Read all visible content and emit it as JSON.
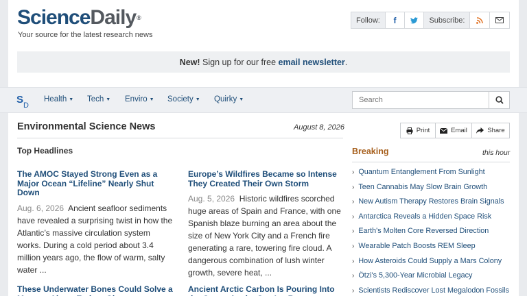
{
  "brand": {
    "science": "Science",
    "daily": "Daily",
    "reg": "®",
    "tagline": "Your source for the latest research news"
  },
  "social": {
    "follow_label": "Follow:",
    "subscribe_label": "Subscribe:"
  },
  "banner": {
    "new_label": "New!",
    "text": " Sign up for our free ",
    "link": "email newsletter",
    "end": "."
  },
  "nav": {
    "logo_s": "S",
    "logo_d": "D",
    "items": [
      {
        "label": "Health"
      },
      {
        "label": "Tech"
      },
      {
        "label": "Enviro"
      },
      {
        "label": "Society"
      },
      {
        "label": "Quirky"
      }
    ],
    "search_placeholder": "Search"
  },
  "main": {
    "title": "Environmental Science News",
    "date": "August 8, 2026",
    "top_headlines": "Top Headlines",
    "stories": [
      {
        "title": "The AMOC Stayed Strong Even as a Major Ocean “Lifeline” Nearly Shut Down",
        "date": "Aug. 6, 2026",
        "summary": "Ancient seafloor sediments have revealed a surprising twist in how the Atlantic’s massive circulation system works. During a cold period about 3.4 million years ago, the flow of warm, salty water ..."
      },
      {
        "title": "Europe’s Wildfires Became so Intense They Created Their Own Storm",
        "date": "Aug. 5, 2026",
        "summary": "Historic wildfires scorched huge areas of Spain and France, with one Spanish blaze burning an area about the size of New York City and a French fire generating a rare, towering fire cloud. A dangerous combination of lush winter growth, severe heat, ..."
      },
      {
        "title": "These Underwater Bones Could Solve a Mystery About Extinct Giants",
        "date": "",
        "summary": ""
      },
      {
        "title": "Ancient Arctic Carbon Is Pouring Into the Ocean As the Sea Ice Retreats",
        "date": "",
        "summary": ""
      }
    ]
  },
  "toolbar": {
    "print": "Print",
    "email": "Email",
    "share": "Share"
  },
  "breaking": {
    "title": "Breaking",
    "subtitle": "this hour",
    "items": [
      "Quantum Entanglement From Sunlight",
      "Teen Cannabis May Slow Brain Growth",
      "New Autism Therapy Restores Brain Signals",
      "Antarctica Reveals a Hidden Space Risk",
      "Earth's Molten Core Reversed Direction",
      "Wearable Patch Boosts REM Sleep",
      "How Asteroids Could Supply a Mars Colony",
      "Ötzi's 5,300-Year Microbial Legacy",
      "Scientists Rediscover Lost Megalodon Fossils"
    ]
  },
  "colors": {
    "brand_blue": "#1f4e79",
    "link_blue": "#1f4e79",
    "breaking_orange": "#a65f1c",
    "facebook": "#1f5ea8",
    "twitter": "#2b9ad4",
    "rss": "#e07020"
  },
  "icons": [
    "facebook-icon",
    "twitter-icon",
    "rss-icon",
    "envelope-icon",
    "search-icon",
    "print-icon",
    "email-icon",
    "share-icon",
    "chevron-right-icon",
    "caret-down-icon"
  ]
}
